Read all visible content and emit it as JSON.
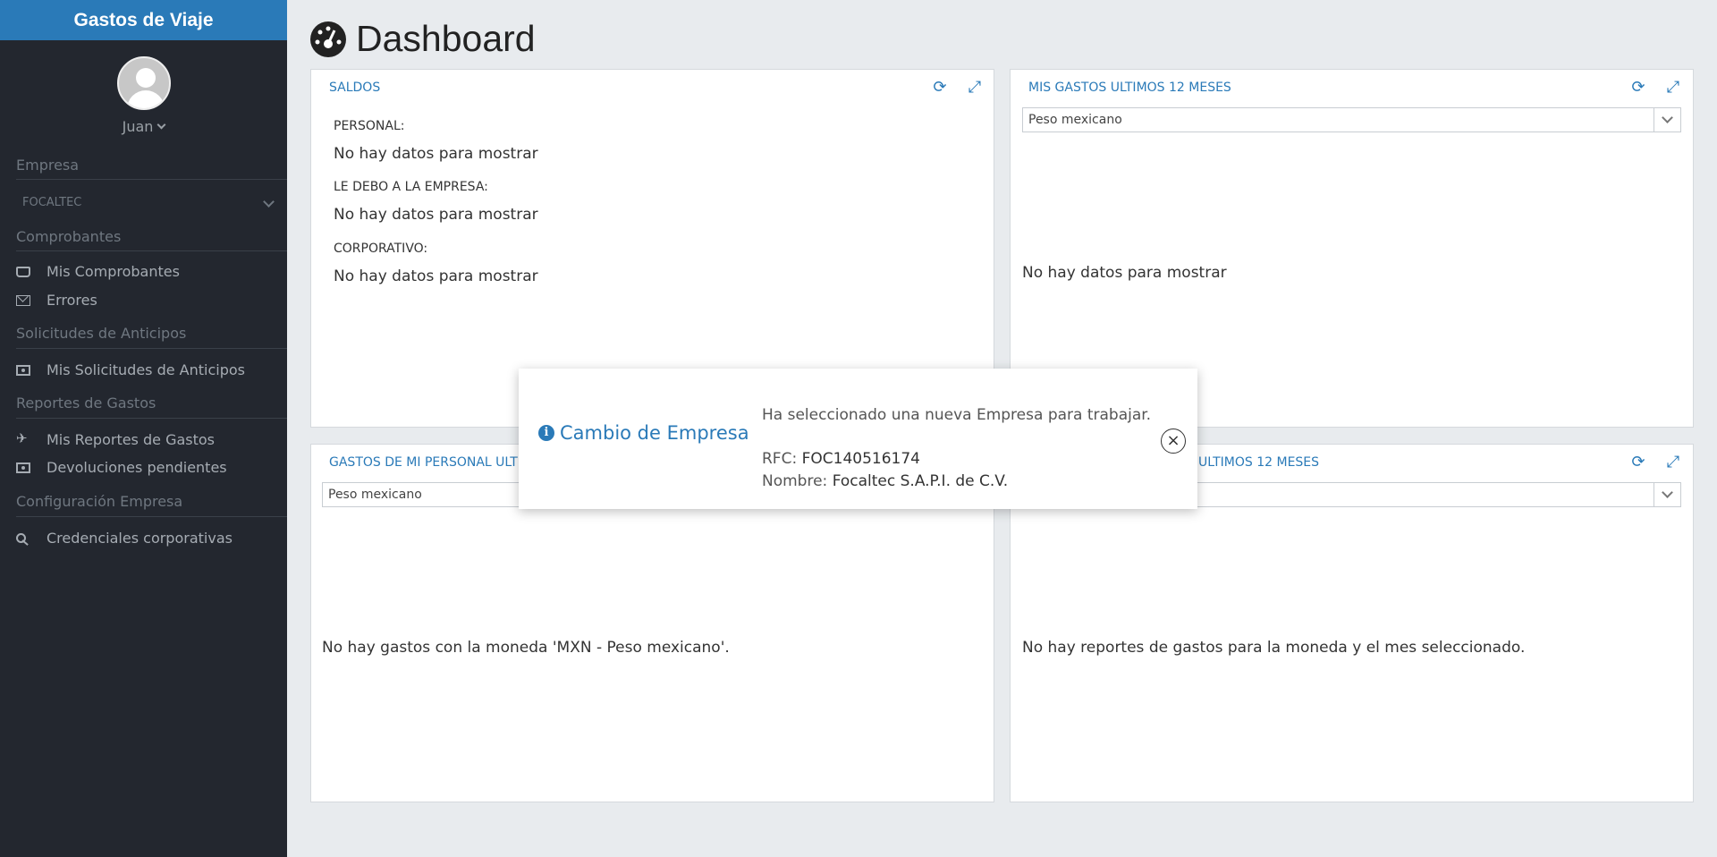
{
  "sidebar": {
    "brand": "Gastos de Viaje",
    "user": "Juan",
    "sections": {
      "empresa": "Empresa",
      "company_value": "FOCALTEC",
      "comprobantes": "Comprobantes",
      "anticipos": "Solicitudes de Anticipos",
      "reportes": "Reportes de Gastos",
      "config": "Configuración Empresa"
    },
    "items": {
      "mis_comprobantes": "Mis Comprobantes",
      "errores": "Errores",
      "mis_solicitudes": "Mis Solicitudes de Anticipos",
      "mis_reportes": "Mis Reportes de Gastos",
      "devoluciones": "Devoluciones pendientes",
      "credenciales": "Credenciales corporativas"
    }
  },
  "header": {
    "title": "Dashboard"
  },
  "panels": {
    "saldos": {
      "title": "SALDOS",
      "personal_label": "PERSONAL:",
      "personal_value": "No hay datos para mostrar",
      "debo_label": "LE DEBO A LA EMPRESA:",
      "debo_value": "No hay datos para mostrar",
      "corp_label": "CORPORATIVO:",
      "corp_value": "No hay datos para mostrar"
    },
    "mis_gastos": {
      "title": "MIS GASTOS ULTIMOS 12 MESES",
      "currency": "Peso mexicano",
      "empty": "No hay datos para mostrar"
    },
    "gastos_personal": {
      "title": "GASTOS DE MI PERSONAL ULT",
      "currency": "Peso mexicano",
      "empty": "No hay gastos con la moneda 'MXN - Peso mexicano'."
    },
    "reportes": {
      "title": "ULTIMOS 12 MESES",
      "empty": "No hay reportes de gastos para la moneda y el mes seleccionado."
    }
  },
  "modal": {
    "title": "Cambio de Empresa",
    "message": "Ha seleccionado una nueva Empresa para trabajar.",
    "rfc_label": "RFC:",
    "rfc_value": "FOC140516174",
    "nombre_label": "Nombre:",
    "nombre_value": "Focaltec S.A.P.I. de C.V.",
    "close": "×"
  },
  "colors": {
    "accent": "#2a7ab8",
    "sidebar": "#23272f",
    "background": "#e8ebee"
  },
  "icons": {
    "refresh": "⟳",
    "expand": "⤢"
  }
}
